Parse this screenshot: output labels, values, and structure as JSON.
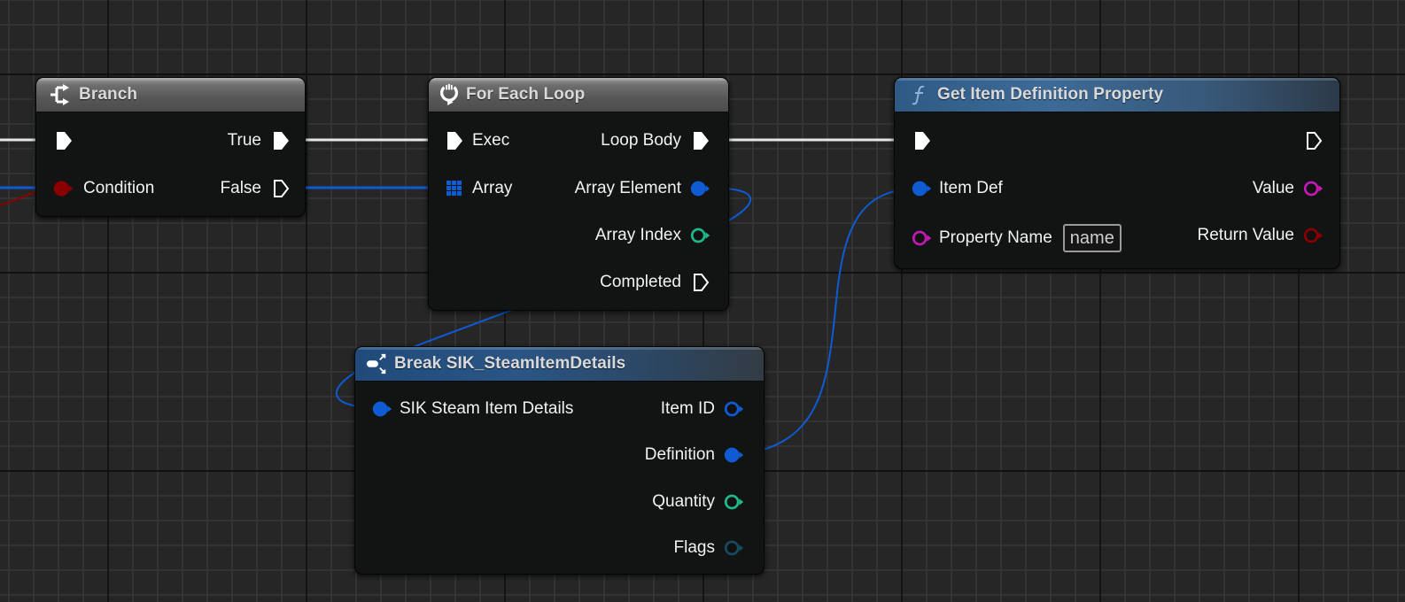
{
  "app": "Blueprint Event Graph",
  "colors": {
    "exec": "#ffffff",
    "object": "#0e5bd4",
    "integer": "#1fb88a",
    "name": "#c219b4",
    "bool": "#8a0000",
    "flags": "#174a5e"
  },
  "nodes": {
    "branch": {
      "title": "Branch",
      "icon": "branch-icon",
      "inputs": [
        {
          "label": "",
          "type": "exec"
        },
        {
          "label": "Condition",
          "type": "bool"
        }
      ],
      "outputs": [
        {
          "label": "True",
          "type": "exec"
        },
        {
          "label": "False",
          "type": "exec"
        }
      ]
    },
    "for_each_loop": {
      "title": "For Each Loop",
      "icon": "loop-icon",
      "inputs": [
        {
          "label": "Exec",
          "type": "exec"
        },
        {
          "label": "Array",
          "type": "array"
        }
      ],
      "outputs": [
        {
          "label": "Loop Body",
          "type": "exec"
        },
        {
          "label": "Array Element",
          "type": "object"
        },
        {
          "label": "Array Index",
          "type": "integer"
        },
        {
          "label": "Completed",
          "type": "exec"
        }
      ]
    },
    "get_item_definition_property": {
      "title": "Get Item Definition Property",
      "icon": "function-icon",
      "inputs": [
        {
          "label": "",
          "type": "exec"
        },
        {
          "label": "Item Def",
          "type": "object"
        },
        {
          "label": "Property Name",
          "type": "name",
          "value": "name"
        }
      ],
      "outputs": [
        {
          "label": "",
          "type": "exec"
        },
        {
          "label": "Value",
          "type": "name"
        },
        {
          "label": "Return Value",
          "type": "bool"
        }
      ]
    },
    "break_struct": {
      "title": "Break SIK_SteamItemDetails",
      "icon": "break-struct-icon",
      "inputs": [
        {
          "label": "SIK Steam Item Details",
          "type": "object"
        }
      ],
      "outputs": [
        {
          "label": "Item ID",
          "type": "object"
        },
        {
          "label": "Definition",
          "type": "object"
        },
        {
          "label": "Quantity",
          "type": "integer"
        },
        {
          "label": "Flags",
          "type": "flags"
        }
      ]
    }
  }
}
